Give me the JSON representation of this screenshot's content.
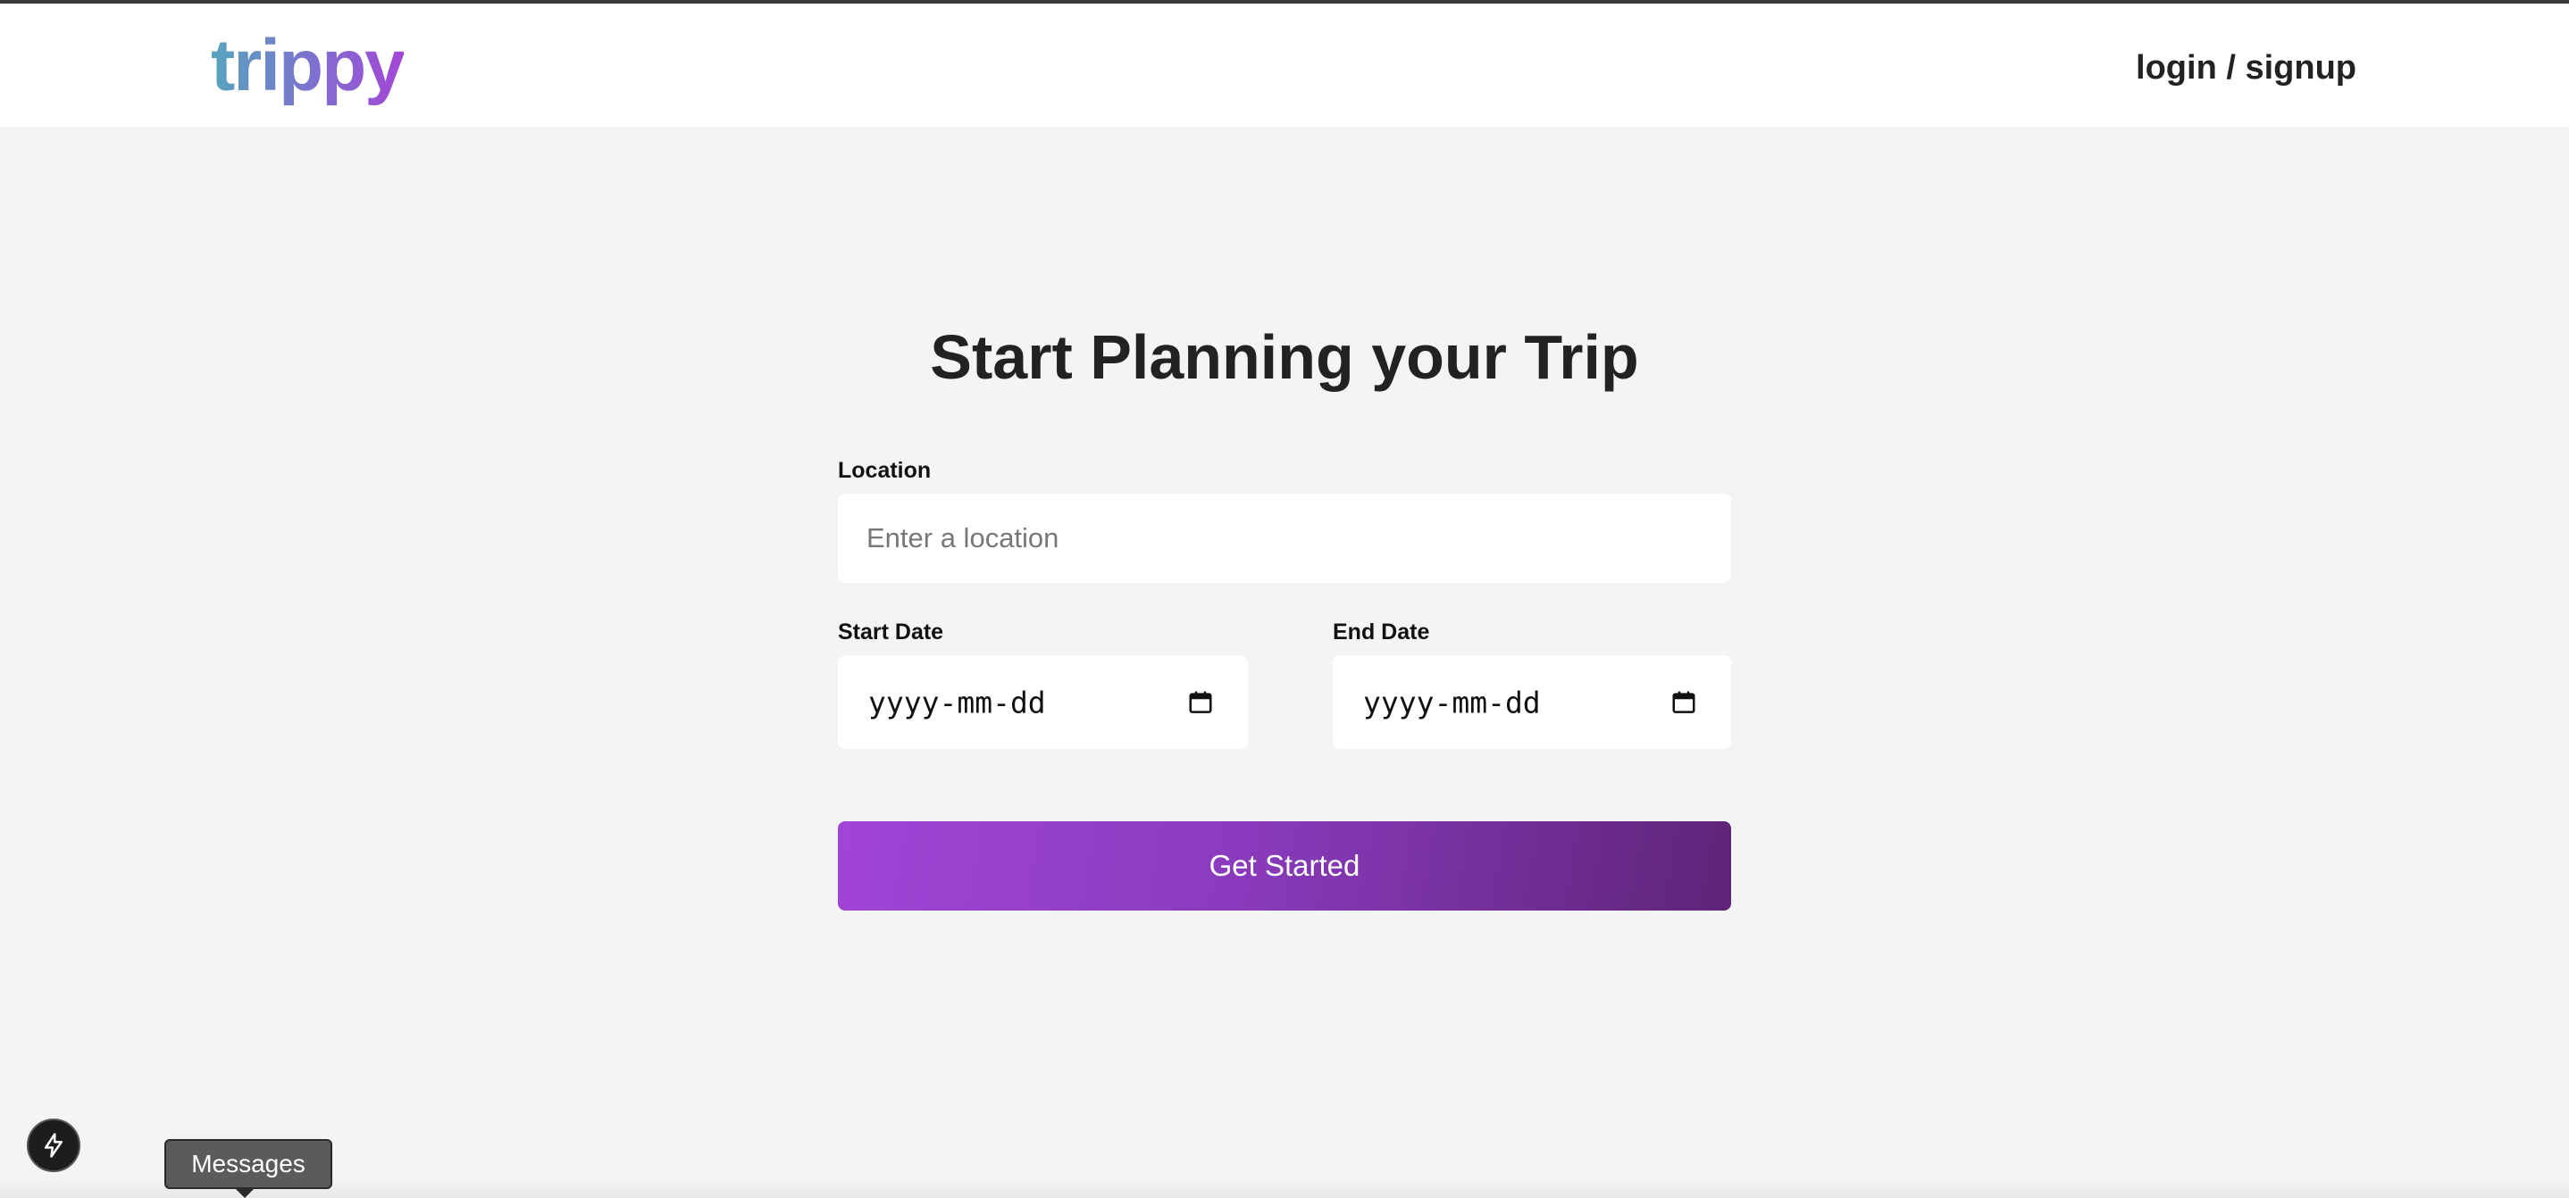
{
  "header": {
    "logo_text": "trippy",
    "auth_link": "login / signup"
  },
  "main": {
    "title": "Start Planning your Trip",
    "location": {
      "label": "Location",
      "placeholder": "Enter a location",
      "value": ""
    },
    "start_date": {
      "label": "Start Date",
      "value": "yyyy-mm-dd"
    },
    "end_date": {
      "label": "End Date",
      "value": "yyyy-mm-dd"
    },
    "submit_label": "Get Started"
  },
  "overlay": {
    "fab_icon": "lightning-icon",
    "tooltip_text": "Messages"
  },
  "colors": {
    "background": "#f3f4f4",
    "navbar": "#ffffff",
    "button_gradient_start": "#a145d8",
    "button_gradient_end": "#5e2478",
    "logo_gradient_start": "#56a5bd",
    "logo_gradient_end": "#a446d6"
  }
}
